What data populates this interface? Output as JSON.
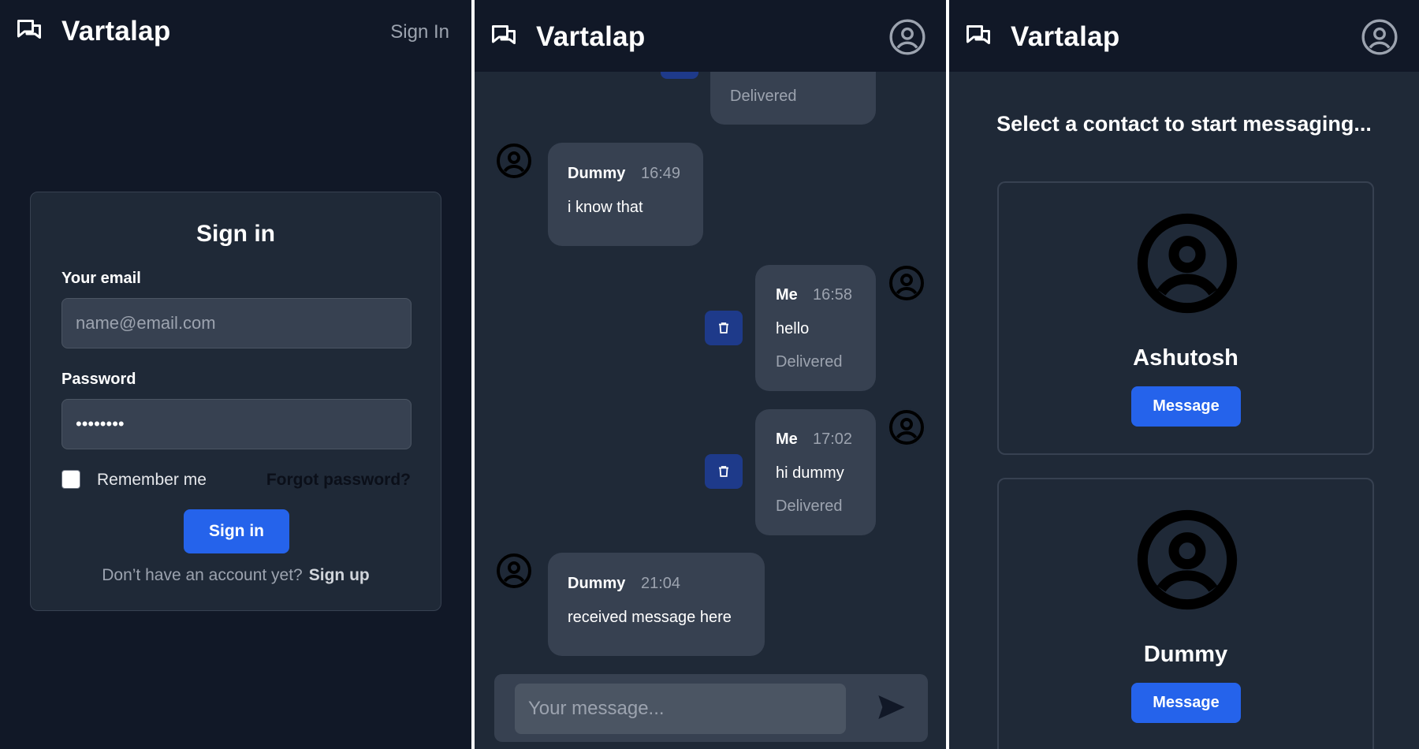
{
  "colors": {
    "page_bg": "#111827",
    "panel_bg": "#1f2937",
    "card_border": "#374151",
    "accent": "#2563eb",
    "delete_button": "#1e3a8a",
    "muted_text": "#9ca3af"
  },
  "signin_screen": {
    "brand": {
      "icon": "chat-bubbles-icon",
      "name": "Vartalap"
    },
    "nav_signin": "Sign In",
    "form": {
      "title": "Sign in",
      "email_label": "Your email",
      "email_placeholder": "name@email.com",
      "password_label": "Password",
      "password_value": "••••••••",
      "remember_label": "Remember me",
      "remember_checked": false,
      "forgot_link": "Forgot password?",
      "submit_label": "Sign in",
      "signup_prompt": "Don’t have an account yet?",
      "signup_link": "Sign up"
    }
  },
  "chat_screen": {
    "brand": {
      "icon": "chat-bubbles-icon",
      "name": "Vartalap"
    },
    "profile_icon": "user-circle-icon",
    "messages": [
      {
        "sender": "Me",
        "time": "",
        "text": "",
        "status": "Delivered",
        "own": true,
        "partial": true
      },
      {
        "sender": "Dummy",
        "time": "16:49",
        "text": "i know that",
        "status": "",
        "own": false
      },
      {
        "sender": "Me",
        "time": "16:58",
        "text": "hello",
        "status": "Delivered",
        "own": true
      },
      {
        "sender": "Me",
        "time": "17:02",
        "text": "hi dummy",
        "status": "Delivered",
        "own": true
      },
      {
        "sender": "Dummy",
        "time": "21:04",
        "text": "received message here",
        "status": "",
        "own": false
      }
    ],
    "composer": {
      "placeholder": "Your message...",
      "send_icon": "send-icon"
    },
    "delete_icon": "trash-icon"
  },
  "contacts_screen": {
    "brand": {
      "icon": "chat-bubbles-icon",
      "name": "Vartalap"
    },
    "profile_icon": "user-circle-icon",
    "heading": "Select a contact to start messaging...",
    "contacts": [
      {
        "name": "Ashutosh",
        "button": "Message"
      },
      {
        "name": "Dummy",
        "button": "Message"
      }
    ]
  }
}
